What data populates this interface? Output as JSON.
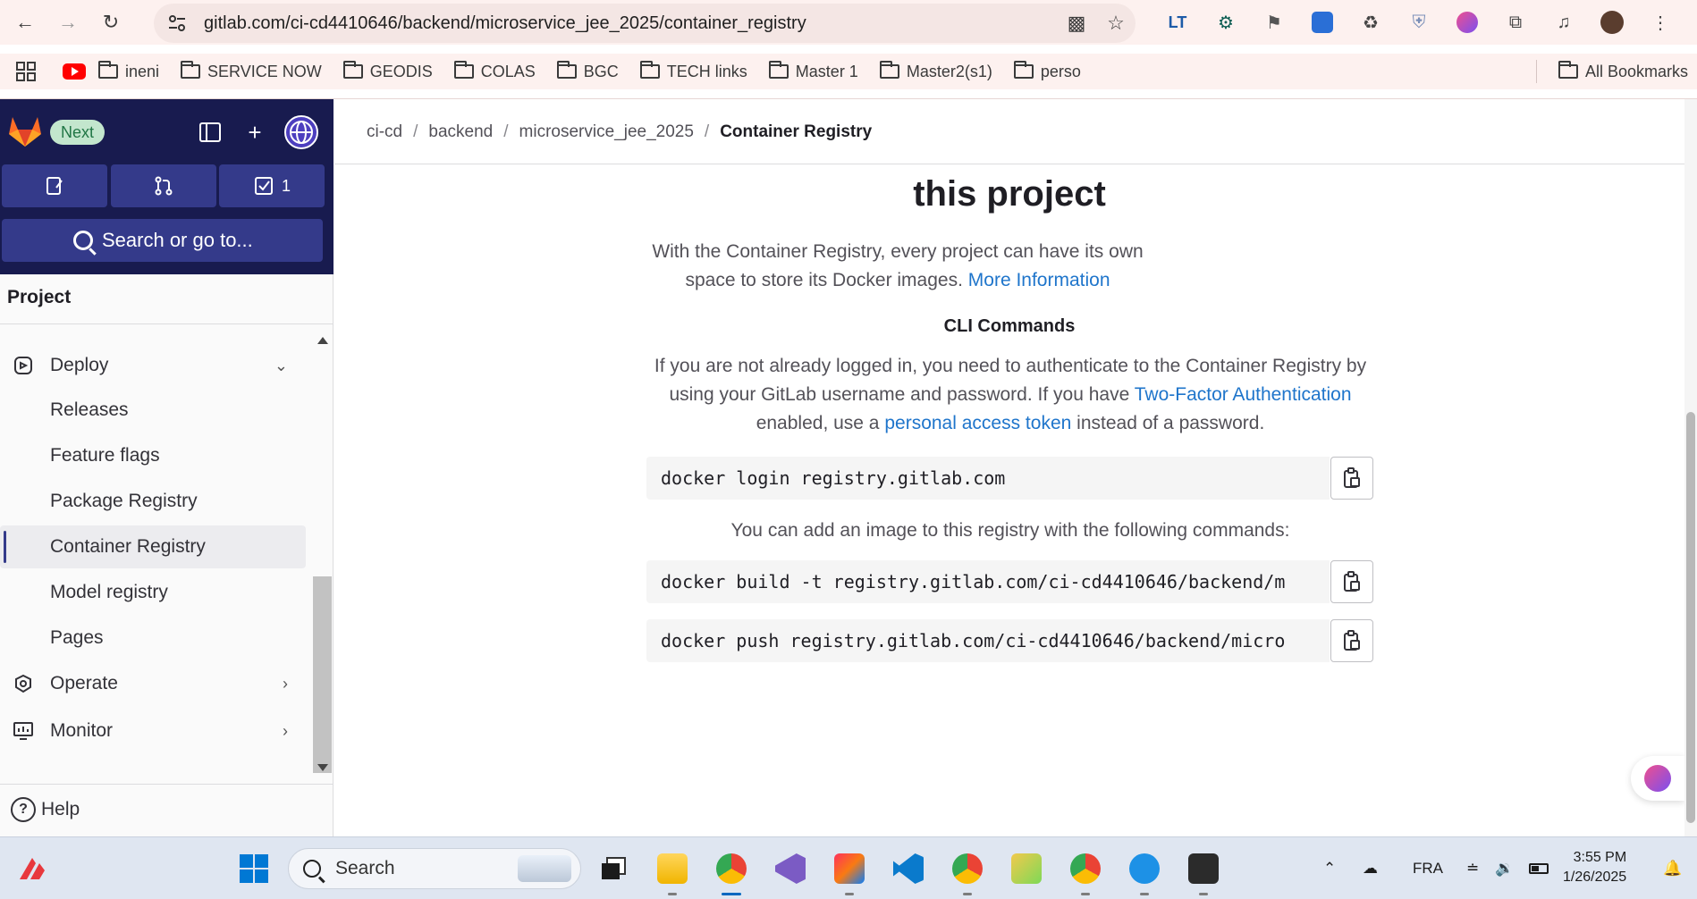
{
  "browser": {
    "url": "gitlab.com/ci-cd4410646/backend/microservice_jee_2025/container_registry",
    "bookmarks": [
      "ineni",
      "SERVICE NOW",
      "GEODIS",
      "COLAS",
      "BGC",
      "TECH links",
      "Master 1",
      "Master2(s1)",
      "perso"
    ],
    "all_bookmarks": "All Bookmarks"
  },
  "sidebar": {
    "next_badge": "Next",
    "todo_count": "1",
    "search_placeholder": "Search or go to...",
    "section_title": "Project",
    "deploy_label": "Deploy",
    "items": [
      "Releases",
      "Feature flags",
      "Package Registry",
      "Container Registry",
      "Model registry",
      "Pages"
    ],
    "active_item": "Container Registry",
    "operate_label": "Operate",
    "monitor_label": "Monitor",
    "help_label": "Help"
  },
  "breadcrumb": {
    "items": [
      "ci-cd",
      "backend",
      "microservice_jee_2025"
    ],
    "current": "Container Registry"
  },
  "main": {
    "heading": "this project",
    "intro_text": "With the Container Registry, every project can have its own space to store its Docker images.",
    "intro_link": "More Information",
    "cli_title": "CLI Commands",
    "auth_text_1": "If you are not already logged in, you need to authenticate to the Container Registry by using your GitLab username and password. If you have",
    "auth_link_1": "Two-Factor Authentication",
    "auth_text_2": "enabled, use a",
    "auth_link_2": "personal access token",
    "auth_text_3": "instead of a password.",
    "login_cmd": "docker login registry.gitlab.com",
    "add_text": "You can add an image to this registry with the following commands:",
    "build_cmd": "docker build -t registry.gitlab.com/ci-cd4410646/backend/m",
    "push_cmd": "docker push registry.gitlab.com/ci-cd4410646/backend/micro"
  },
  "taskbar": {
    "search_label": "Search",
    "language": "FRA",
    "time": "3:55 PM",
    "date": "1/26/2025"
  },
  "colors": {
    "sidebar_dark": "#181b4f",
    "link": "#1f75cb",
    "chrome_bg": "#fdf1ef"
  }
}
